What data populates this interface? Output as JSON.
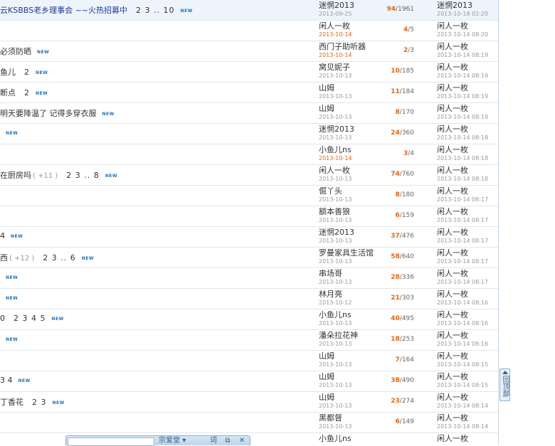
{
  "threads": [
    {
      "title": "云KSBBS老乡理事会 ~~火热招募中",
      "pages": "2 3 .. 10",
      "extra": "",
      "new_badge": "NEW",
      "sticky": true,
      "author": "迷惘2013",
      "date": "2013-09-25",
      "date_today": false,
      "replies": "94",
      "views": "1961",
      "last_user": "迷惘2013",
      "last_time": "2013-10-18 02:20"
    },
    {
      "title": "",
      "pages": "",
      "extra": "",
      "new_badge": "",
      "sticky": false,
      "author": "闲人一枚",
      "date": "2013-10-14",
      "date_today": true,
      "replies": "4",
      "views": "5",
      "last_user": "闲人一枚",
      "last_time": "2013-10-14 08:20"
    },
    {
      "title": "必须防晒",
      "pages": "",
      "extra": "",
      "new_badge": "NEW",
      "sticky": false,
      "author": "西门子助听器",
      "date": "2013-10-14",
      "date_today": true,
      "replies": "2",
      "views": "3",
      "last_user": "闲人一枚",
      "last_time": "2013-10-14 08:19"
    },
    {
      "title": "鱼儿",
      "pages": "2",
      "extra": "",
      "new_badge": "NEW",
      "sticky": false,
      "author": "窝见妮子",
      "date": "2013-10-13",
      "date_today": false,
      "replies": "10",
      "views": "185",
      "last_user": "闲人一枚",
      "last_time": "2013-10-14 08:19"
    },
    {
      "title": "断点",
      "pages": "2",
      "extra": "",
      "new_badge": "NEW",
      "sticky": false,
      "author": "山姆",
      "date": "2013-10-13",
      "date_today": false,
      "replies": "11",
      "views": "184",
      "last_user": "闲人一枚",
      "last_time": "2013-10-14 08:19"
    },
    {
      "title": "明天要降温了 记得多穿衣服",
      "pages": "",
      "extra": "",
      "new_badge": "NEW",
      "sticky": false,
      "author": "山姆",
      "date": "2013-10-13",
      "date_today": false,
      "replies": "8",
      "views": "170",
      "last_user": "闲人一枚",
      "last_time": "2013-10-14 08:19"
    },
    {
      "title": "",
      "pages": "",
      "extra": "",
      "new_badge": "NEW",
      "sticky": false,
      "author": "迷惘2013",
      "date": "2013-10-13",
      "date_today": false,
      "replies": "24",
      "views": "360",
      "last_user": "闲人一枚",
      "last_time": "2013-10-14 08:18"
    },
    {
      "title": "",
      "pages": "",
      "extra": "",
      "new_badge": "",
      "sticky": false,
      "author": "小鱼儿ns",
      "date": "2013-10-14",
      "date_today": true,
      "replies": "3",
      "views": "4",
      "last_user": "闲人一枚",
      "last_time": "2013-10-14 08:18"
    },
    {
      "title": "在厨房吗",
      "pages": "2 3 .. 8",
      "extra": "( +11 )",
      "new_badge": "NEW",
      "sticky": false,
      "author": "闲人一枚",
      "date": "2013-10-13",
      "date_today": false,
      "replies": "74",
      "views": "760",
      "last_user": "闲人一枚",
      "last_time": "2013-10-14 08:18"
    },
    {
      "title": "",
      "pages": "",
      "extra": "",
      "new_badge": "",
      "sticky": false,
      "author": "倔丫头",
      "date": "2013-10-13",
      "date_today": false,
      "replies": "8",
      "views": "180",
      "last_user": "闲人一枚",
      "last_time": "2013-10-14 08:17"
    },
    {
      "title": "",
      "pages": "",
      "extra": "",
      "new_badge": "",
      "sticky": false,
      "author": "额本善狼",
      "date": "2013-10-13",
      "date_today": false,
      "replies": "6",
      "views": "159",
      "last_user": "闲人一枚",
      "last_time": "2013-10-14 08:17"
    },
    {
      "title": "4",
      "pages": "",
      "extra": "",
      "new_badge": "NEW",
      "sticky": false,
      "author": "迷惘2013",
      "date": "2013-10-13",
      "date_today": false,
      "replies": "37",
      "views": "476",
      "last_user": "闲人一枚",
      "last_time": "2013-10-14 08:17"
    },
    {
      "title": "西",
      "pages": "2 3 .. 6",
      "extra": "( +12 )",
      "new_badge": "NEW",
      "sticky": false,
      "author": "罗曼家具生活馆",
      "date": "2013-10-13",
      "date_today": false,
      "replies": "58",
      "views": "640",
      "last_user": "闲人一枚",
      "last_time": "2013-10-14 08:17"
    },
    {
      "title": "",
      "pages": "",
      "extra": "",
      "new_badge": "NEW",
      "sticky": false,
      "author": "串场哥",
      "date": "2013-10-13",
      "date_today": false,
      "replies": "28",
      "views": "336",
      "last_user": "闲人一枚",
      "last_time": "2013-10-14 08:17"
    },
    {
      "title": "",
      "pages": "",
      "extra": "",
      "new_badge": "NEW",
      "sticky": false,
      "author": "林月亮",
      "date": "2013-10-12",
      "date_today": false,
      "replies": "21",
      "views": "303",
      "last_user": "闲人一枚",
      "last_time": "2013-10-14 08:16"
    },
    {
      "title": "0",
      "pages": "2 3 4 5",
      "extra": "",
      "new_badge": "NEW",
      "sticky": false,
      "author": "小鱼儿ns",
      "date": "2013-10-13",
      "date_today": false,
      "replies": "40",
      "views": "495",
      "last_user": "闲人一枚",
      "last_time": "2013-10-14 08:16"
    },
    {
      "title": "",
      "pages": "",
      "extra": "",
      "new_badge": "NEW",
      "sticky": false,
      "author": "潘朵拉花神",
      "date": "2013-10-13",
      "date_today": false,
      "replies": "18",
      "views": "253",
      "last_user": "闲人一枚",
      "last_time": "2013-10-14 08:16"
    },
    {
      "title": "",
      "pages": "",
      "extra": "",
      "new_badge": "",
      "sticky": false,
      "author": "山姆",
      "date": "2013-10-13",
      "date_today": false,
      "replies": "7",
      "views": "164",
      "last_user": "闲人一枚",
      "last_time": "2013-10-14 08:15"
    },
    {
      "title": "3 4",
      "pages": "",
      "extra": "",
      "new_badge": "NEW",
      "sticky": false,
      "author": "山姆",
      "date": "2013-10-13",
      "date_today": false,
      "replies": "38",
      "views": "490",
      "last_user": "闲人一枚",
      "last_time": "2013-10-14 08:15"
    },
    {
      "title": "丁香花",
      "pages": "2 3",
      "extra": "",
      "new_badge": "NEW",
      "sticky": false,
      "author": "山姆",
      "date": "2013-10-13",
      "date_today": false,
      "replies": "23",
      "views": "274",
      "last_user": "闲人一枚",
      "last_time": "2013-10-14 08:14"
    },
    {
      "title": "",
      "pages": "",
      "extra": "",
      "new_badge": "",
      "sticky": false,
      "author": "黑都督",
      "date": "2013-10-13",
      "date_today": false,
      "replies": "6",
      "views": "149",
      "last_user": "闲人一枚",
      "last_time": "2013-10-14 08:14"
    },
    {
      "title": "",
      "pages": "",
      "extra": "",
      "new_badge": "",
      "sticky": false,
      "author": "小鱼儿ns",
      "date": "",
      "date_today": false,
      "replies": "",
      "views": "",
      "last_user": "闲人一枚",
      "last_time": ""
    }
  ],
  "back_to_top": {
    "label": "回顶部"
  },
  "chatbar": {
    "dropdown": "宗爱堂",
    "btn_word": "词",
    "btn_copy": "⧉",
    "btn_close": "✕"
  },
  "colors": {
    "accent": "#e06616",
    "link": "#1f3a93",
    "badge": "#1f6fb5"
  }
}
